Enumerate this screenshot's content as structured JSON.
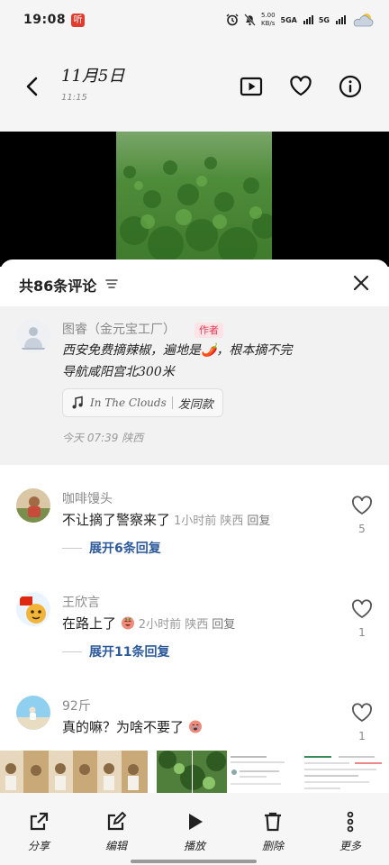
{
  "status": {
    "time": "19:08",
    "app_badge": "听",
    "net_speed_value": "5.00",
    "net_speed_unit": "KB/s",
    "sim1": "5GA",
    "sim2": "5G"
  },
  "header": {
    "title": "11月5日",
    "subtitle": "11:15",
    "icons": [
      "back-icon",
      "play-slideshow-icon",
      "heart-icon",
      "info-icon"
    ]
  },
  "comments_panel": {
    "title": "共86条评论",
    "author_comment": {
      "name": "图睿（金元宝工厂）",
      "tag": "作者",
      "text_line1": "西安免费摘辣椒，遍地是🌶️，根本摘不完",
      "text_line2": "导航咸阳宫北300米",
      "music_title": "In The Clouds",
      "music_action": "发同款",
      "meta": "今天 07:39 陕西"
    },
    "comments": [
      {
        "name": "咖啡馒头",
        "text": "不让摘了警察来了",
        "meta": "1小时前 陕西",
        "reply": "回复",
        "expand": "展开6条回复",
        "likes": "5"
      },
      {
        "name": "王欣言",
        "text": "在路上了",
        "meta": "2小时前 陕西",
        "reply": "回复",
        "expand": "展开11条回复",
        "likes": "1"
      },
      {
        "name": "92斤",
        "text": "真的嘛？为啥不要了",
        "meta": "",
        "reply": "",
        "expand": "",
        "likes": "1"
      }
    ]
  },
  "toolbar": {
    "items": [
      {
        "label": "分享",
        "icon": "share-icon"
      },
      {
        "label": "编辑",
        "icon": "edit-icon"
      },
      {
        "label": "播放",
        "icon": "play-icon"
      },
      {
        "label": "删除",
        "icon": "trash-icon"
      },
      {
        "label": "更多",
        "icon": "more-icon"
      }
    ]
  },
  "colors": {
    "accent_blue": "#2d5a9b",
    "tag_red": "#e63b57",
    "tag_bg": "#fde3e6",
    "badge_red": "#e23b2e"
  }
}
